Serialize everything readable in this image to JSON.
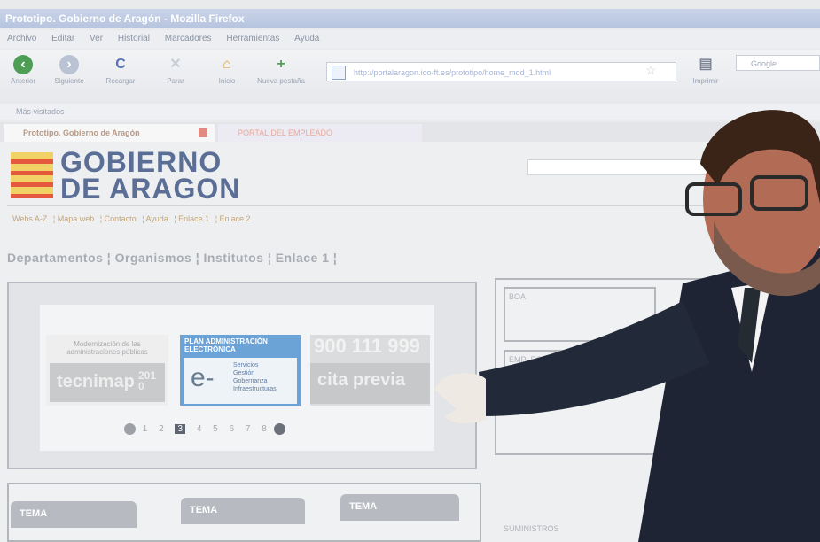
{
  "window": {
    "title": "Prototipo. Gobierno de Aragón - Mozilla Firefox"
  },
  "menu": [
    "Archivo",
    "Editar",
    "Ver",
    "Historial",
    "Marcadores",
    "Herramientas",
    "Ayuda"
  ],
  "toolbar": {
    "back": "Anterior",
    "forward": "Siguiente",
    "reload": "Recargar",
    "stop": "Parar",
    "home": "Inicio",
    "new_tab": "Nueva pestaña",
    "print": "Imprimir",
    "search_placeholder": "Google",
    "url": "http://portalaragon.ioo-ft.es/prototipo/home_mod_1.html"
  },
  "bookmarks": {
    "most_visited": "Más visitados"
  },
  "tabs": [
    {
      "label": "Prototipo. Gobierno de Aragón"
    },
    {
      "label": "PORTAL DEL EMPLEADO"
    }
  ],
  "site": {
    "logo_line1": "GOBIERNO",
    "logo_line2": "DE ARAGON",
    "top_links": [
      "Webs A-Z",
      "Mapa web",
      "Contacto",
      "Ayuda",
      "Enlace 1",
      "Enlace 2"
    ],
    "departments": "Departamentos ¦ Organismos ¦ Institutos ¦ Enlace 1 ¦",
    "banners": {
      "b1_text": "Modernización de las administraciones públicas",
      "b1_brand": "tecnimap",
      "b1_year": "2010",
      "b2_title": "PLAN ADMINISTRACIÓN ELECTRÓNICA",
      "b2_symbol": "e-",
      "b2_items": [
        "Servicios",
        "Gestión",
        "Gobernanza",
        "Infraestructuras"
      ],
      "b3_phone": "900 111 999",
      "b3_label": "cita previa"
    },
    "pager": [
      "1",
      "2",
      "3",
      "4",
      "5",
      "6",
      "7",
      "8"
    ],
    "pager_active": "3",
    "right_boxes": [
      "BOA",
      "EMPLEO"
    ],
    "tema_label": "TEMA",
    "bottom_right": "SUMINISTROS"
  },
  "colors": {
    "logo_text": "#5a6e96",
    "flag_yellow": "#f1d267",
    "flag_red": "#e55a3f",
    "banner_blue": "#6ca3d6",
    "suit": "#1e2433"
  }
}
